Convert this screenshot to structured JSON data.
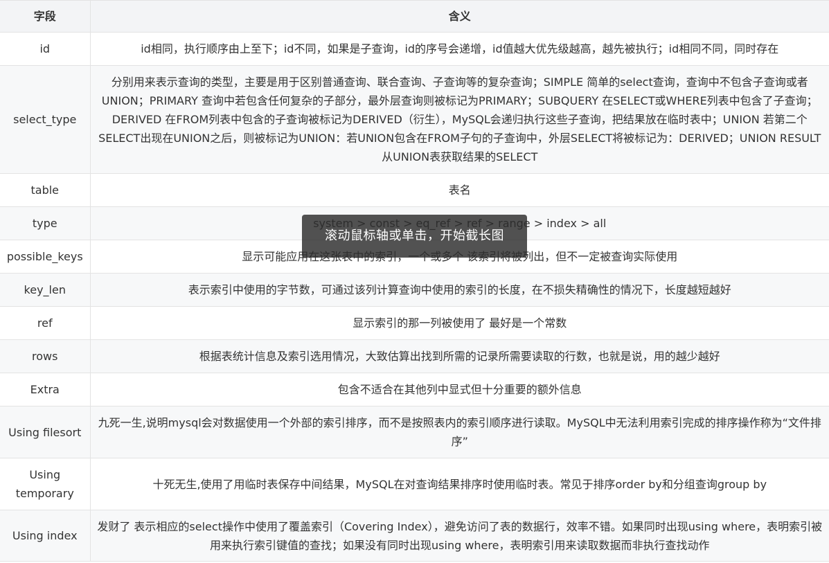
{
  "table": {
    "headers": [
      "字段",
      "含义"
    ],
    "rows": [
      {
        "field": "id",
        "meaning": "id相同，执行顺序由上至下；id不同，如果是子查询，id的序号会递增，id值越大优先级越高，越先被执行；id相同不同，同时存在"
      },
      {
        "field": "select_type",
        "meaning": "分别用来表示查询的类型，主要是用于区别普通查询、联合查询、子查询等的复杂查询；SIMPLE 简单的select查询，查询中不包含子查询或者UNION；PRIMARY 查询中若包含任何复杂的子部分，最外层查询则被标记为PRIMARY；SUBQUERY 在SELECT或WHERE列表中包含了子查询；DERIVED 在FROM列表中包含的子查询被标记为DERIVED（衍生），MySQL会递归执行这些子查询，把结果放在临时表中；UNION 若第二个SELECT出现在UNION之后，则被标记为UNION：若UNION包含在FROM子句的子查询中，外层SELECT将被标记为：DERIVED；UNION RESULT 从UNION表获取结果的SELECT"
      },
      {
        "field": "table",
        "meaning": "表名"
      },
      {
        "field": "type",
        "meaning": "system > const > eq_ref > ref > range > index > all"
      },
      {
        "field": "possible_keys",
        "meaning": "显示可能应用在这张表中的索引，一个或多个 该索引将被列出，但不一定被查询实际使用"
      },
      {
        "field": "key_len",
        "meaning": "表示索引中使用的字节数，可通过该列计算查询中使用的索引的长度，在不损失精确性的情况下，长度越短越好"
      },
      {
        "field": "ref",
        "meaning": "显示索引的那一列被使用了 最好是一个常数"
      },
      {
        "field": "rows",
        "meaning": "根据表统计信息及索引选用情况，大致估算出找到所需的记录所需要读取的行数，也就是说，用的越少越好"
      },
      {
        "field": "Extra",
        "meaning": "包含不适合在其他列中显式但十分重要的额外信息"
      },
      {
        "field": "Using filesort",
        "meaning": "九死一生,说明mysql会对数据使用一个外部的索引排序，而不是按照表内的索引顺序进行读取。MySQL中无法利用索引完成的排序操作称为“文件排序”"
      },
      {
        "field": "Using temporary",
        "meaning": "十死无生,使用了用临时表保存中间结果，MySQL在对查询结果排序时使用临时表。常见于排序order by和分组查询group by"
      },
      {
        "field": "Using index",
        "meaning": "发财了 表示相应的select操作中使用了覆盖索引（Covering Index），避免访问了表的数据行，效率不错。如果同时出现using where，表明索引被用来执行索引键值的查找；如果没有同时出现using where，表明索引用来读取数据而非执行查找动作"
      }
    ]
  },
  "toast": {
    "text": "滚动鼠标轴或单击，开始截长图"
  }
}
